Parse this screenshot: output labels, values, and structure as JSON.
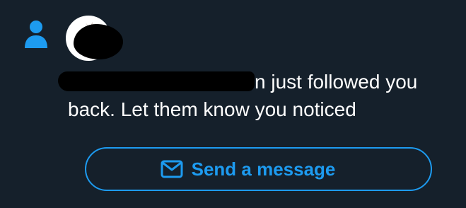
{
  "notification": {
    "type_icon": "person-icon",
    "avatar_icon": "profile-avatar",
    "text": "n just followed you back. Let them know you noticed",
    "action": {
      "label": "Send a message",
      "icon": "mail-icon"
    }
  },
  "colors": {
    "background": "#15202b",
    "accent": "#1d9bf0",
    "text": "#ffffff",
    "redaction": "#000000"
  }
}
